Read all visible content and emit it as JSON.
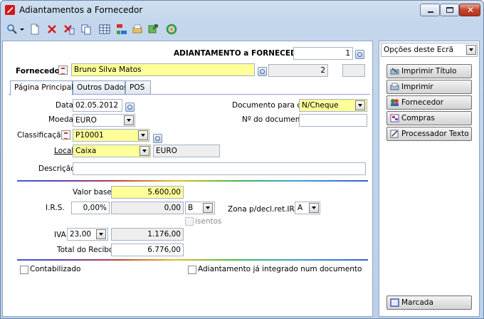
{
  "window": {
    "title": "Adiantamentos a Fornecedor"
  },
  "toolbar": {
    "icons": [
      "search-icon",
      "new-document-icon",
      "delete-icon",
      "cancel-document-icon",
      "copy-icon",
      "grid-icon",
      "structure-icon",
      "print-preview-icon",
      "export-icon",
      "refresh-icon"
    ]
  },
  "header": {
    "doc_label": "ADIANTAMENTO a FORNECEDOR nº",
    "doc_number": "1",
    "supplier_label": "Fornecedor",
    "supplier_name": "Bruno Silva Matos",
    "supplier_code": "2"
  },
  "tabs": [
    {
      "label": "Página Principal"
    },
    {
      "label": "Outros Dados"
    },
    {
      "label": "POS"
    }
  ],
  "form": {
    "date_label": "Data",
    "date_value": "02.05.2012",
    "currency_label": "Moeda",
    "currency_value": "EURO",
    "classification_label": "Classificação",
    "classification_value": "P10001",
    "local_label": "Local",
    "local_value": "Caixa",
    "local_currency": "EURO",
    "description_label": "Descrição",
    "description_value": "",
    "doc_for_cc_label": "Documento para c/c",
    "doc_for_cc_value": "N/Cheque",
    "doc_number_label": "Nº do documento",
    "doc_number_value": "",
    "base_label": "Valor base",
    "base_value": "5.600,00",
    "irs_label": "I.R.S.",
    "irs_pct": "0,00%",
    "irs_value": "0,00",
    "irs_type": "B",
    "exempt_label": "isentos",
    "zone_label": "Zona p/decl.ret.IRS",
    "zone_value": "A",
    "iva_label": "IVA",
    "iva_pct": "23,00",
    "iva_value": "1.176,00",
    "total_label": "Total do Recibo",
    "total_value": "6.776,00",
    "accounted_label": "Contabilizado",
    "integrated_label": "Adiantamento já integrado num documento"
  },
  "sidebar": {
    "options_label": "Opções deste Ecrã",
    "buttons": [
      {
        "label": "Imprimir Título"
      },
      {
        "label": "Imprimir"
      },
      {
        "label": "Fornecedor"
      },
      {
        "label": "Compras"
      },
      {
        "label": "Processador Texto"
      }
    ],
    "bottom_button": "Marcada"
  },
  "colors": {
    "highlight": "#ffff9a",
    "readonly": "#eeeeee",
    "accent": "#3a5cd4"
  }
}
